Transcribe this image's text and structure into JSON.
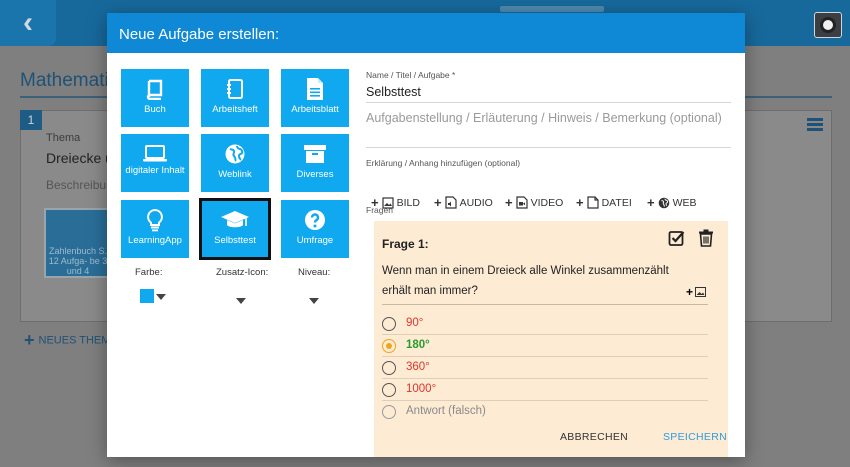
{
  "background": {
    "page_title": "Mathemati",
    "section_number": "1",
    "thema_label": "Thema",
    "thema_value": "Dreiecke u",
    "beschreibung": "Beschreibun",
    "tile_text": "Zahlenbuch S. 12 Aufga- be 3 und 4",
    "new_topic": "NEUES THEM"
  },
  "modal": {
    "title": "Neue Aufgabe erstellen:",
    "tiles": [
      {
        "label": "Buch",
        "icon": "book-icon"
      },
      {
        "label": "Arbeitsheft",
        "icon": "notebook-icon"
      },
      {
        "label": "Arbeitsblatt",
        "icon": "document-icon"
      },
      {
        "label": "digitaler Inhalt",
        "icon": "laptop-icon"
      },
      {
        "label": "Weblink",
        "icon": "globe-icon"
      },
      {
        "label": "Diverses",
        "icon": "archive-box-icon"
      },
      {
        "label": "LearningApp",
        "icon": "lightbulb-icon"
      },
      {
        "label": "Selbsttest",
        "icon": "graduation-cap-icon",
        "selected": true
      },
      {
        "label": "Umfrage",
        "icon": "question-mark-icon"
      }
    ],
    "options": {
      "farbe_label": "Farbe:",
      "zusatz_label": "Zusatz-Icon:",
      "niveau_label": "Niveau:",
      "farbe_color": "#10a8ef"
    },
    "name_label": "Name / Titel / Aufgabe *",
    "name_value": "Selbsttest",
    "description_placeholder": "Aufgabenstellung / Erläuterung / Hinweis / Bemerkung (optional)",
    "attachment_label": "Erklärung / Anhang hinzufügen (optional)",
    "attachments": [
      {
        "label": "BILD",
        "icon": "image-icon"
      },
      {
        "label": "AUDIO",
        "icon": "audio-file-icon"
      },
      {
        "label": "VIDEO",
        "icon": "video-file-icon"
      },
      {
        "label": "DATEI",
        "icon": "file-icon"
      },
      {
        "label": "WEB",
        "icon": "globe-icon"
      }
    ],
    "questions_label": "Fragen",
    "question": {
      "title": "Frage 1:",
      "text": "Wenn man in einem Dreieck alle Winkel zusammenzählt erhält man immer?",
      "answers": [
        {
          "text": "90°",
          "correct": false,
          "selected": false
        },
        {
          "text": "180°",
          "correct": true,
          "selected": true
        },
        {
          "text": "360°",
          "correct": false,
          "selected": false
        },
        {
          "text": "1000°",
          "correct": false,
          "selected": false
        }
      ],
      "new_answer_placeholder": "Antwort (falsch)"
    },
    "cancel_label": "ABBRECHEN",
    "save_label": "SPEICHERN"
  }
}
